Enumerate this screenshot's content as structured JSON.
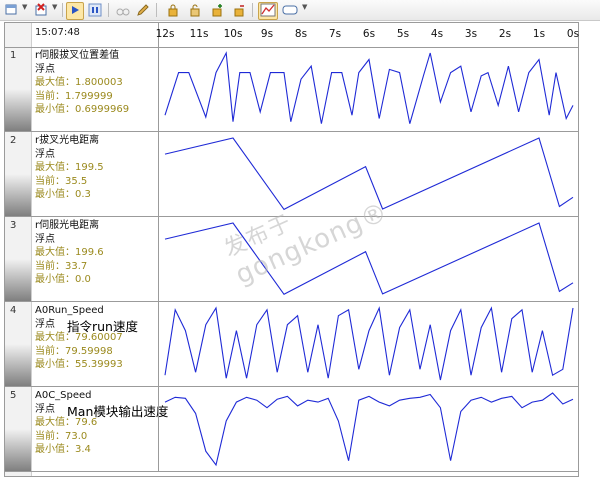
{
  "toolbar": {
    "buttons": [
      "add-channel-icon",
      "remove-channel-icon",
      "start-icon",
      "pause-icon",
      "binoculars-icon",
      "pencil-icon",
      "lock-icon",
      "lock-open-icon",
      "lock-add-icon",
      "lock-remove-icon",
      "chart-icon",
      "display-icon"
    ],
    "active": [
      "start-icon",
      "chart-icon"
    ]
  },
  "header": {
    "time": "15:07:48"
  },
  "axis": {
    "ticks": [
      "12s",
      "11s",
      "10s",
      "9s",
      "8s",
      "7s",
      "6s",
      "5s",
      "4s",
      "3s",
      "2s",
      "1s",
      "0s"
    ]
  },
  "channels": [
    {
      "num": "1",
      "name": "r伺服拔叉位置差值",
      "type": "浮点",
      "max": "最大值：1.800003",
      "cur": "当前：1.799999",
      "min": "最小值：0.6999969",
      "note": ""
    },
    {
      "num": "2",
      "name": "r拔叉光电距离",
      "type": "浮点",
      "max": "最大值：199.5",
      "cur": "当前：35.5",
      "min": "最小值：0.3",
      "note": ""
    },
    {
      "num": "3",
      "name": "r伺服光电距离",
      "type": "浮点",
      "max": "最大值：199.6",
      "cur": "当前：33.7",
      "min": "最小值：0.0",
      "note": ""
    },
    {
      "num": "4",
      "name": "A0Run_Speed",
      "type": "浮点",
      "max": "最大值：79.60007",
      "cur": "当前：79.59998",
      "min": "最小值：55.39993",
      "note": "指令run速度"
    },
    {
      "num": "5",
      "name": "A0C_Speed",
      "type": "浮点",
      "max": "最大值：79.6",
      "cur": "当前：73.0",
      "min": "最小值：3.4",
      "note": "Man模块输出速度"
    }
  ],
  "watermark": {
    "line1": "发布于",
    "line2": "gongkong®"
  },
  "colors": {
    "trace": "#1f2ad6",
    "stat": "#9b8a1e",
    "grid": "#9b9b9b"
  },
  "chart_data": [
    {
      "type": "line",
      "channel": "r伺服拔叉位置差值",
      "x_unit": "s before now",
      "xlim": [
        12,
        0
      ],
      "ylim": [
        0.6999969,
        1.800003
      ],
      "x": [
        12,
        11.6,
        11.3,
        10.8,
        10.5,
        10.2,
        10.0,
        9.8,
        9.5,
        9.2,
        8.9,
        8.5,
        8.3,
        8.0,
        7.7,
        7.4,
        7.1,
        6.8,
        6.5,
        6.3,
        6.0,
        5.7,
        5.4,
        5.1,
        4.8,
        4.4,
        4.2,
        3.9,
        3.6,
        3.3,
        3.0,
        2.7,
        2.5,
        2.2,
        1.9,
        1.6,
        1.3,
        1.0,
        0.7,
        0.5,
        0.2,
        0.0
      ],
      "y": [
        0.85,
        1.5,
        1.5,
        0.82,
        1.5,
        1.8,
        0.75,
        1.5,
        1.5,
        0.9,
        1.5,
        1.5,
        0.75,
        1.4,
        1.6,
        0.72,
        1.5,
        1.5,
        0.85,
        1.5,
        1.7,
        0.8,
        1.55,
        1.5,
        0.72,
        1.45,
        1.8,
        1.05,
        1.5,
        1.6,
        0.9,
        1.45,
        1.5,
        1.0,
        1.6,
        0.9,
        1.5,
        1.7,
        0.85,
        1.5,
        0.8,
        1.0
      ]
    },
    {
      "type": "line",
      "channel": "r拔叉光电距离",
      "x_unit": "s before now",
      "xlim": [
        12,
        0
      ],
      "ylim": [
        0.3,
        199.5
      ],
      "x": [
        12,
        10.0,
        8.5,
        6.1,
        5.6,
        1.0,
        0.4,
        0.0
      ],
      "y": [
        155,
        199.5,
        2,
        120,
        3,
        199.5,
        10,
        35.5
      ]
    },
    {
      "type": "line",
      "channel": "r伺服光电距离",
      "x_unit": "s before now",
      "xlim": [
        12,
        0
      ],
      "ylim": [
        0.0,
        199.6
      ],
      "x": [
        12,
        10.0,
        8.5,
        6.1,
        5.6,
        1.0,
        0.4,
        0.0
      ],
      "y": [
        155,
        199.6,
        2,
        120,
        3,
        199.6,
        10,
        33.7
      ]
    },
    {
      "type": "line",
      "channel": "A0Run_Speed",
      "x_unit": "s before now",
      "xlim": [
        12,
        0
      ],
      "ylim": [
        55.39993,
        79.60007
      ],
      "x": [
        12,
        11.7,
        11.4,
        11.1,
        10.8,
        10.5,
        10.2,
        9.9,
        9.6,
        9.3,
        9.0,
        8.7,
        8.4,
        8.1,
        7.8,
        7.5,
        7.2,
        6.9,
        6.6,
        6.3,
        6.0,
        5.7,
        5.4,
        5.1,
        4.8,
        4.5,
        4.2,
        3.9,
        3.6,
        3.3,
        3.0,
        2.7,
        2.4,
        2.1,
        1.8,
        1.5,
        1.2,
        0.9,
        0.6,
        0.3,
        0.0
      ],
      "y": [
        57,
        79,
        72,
        58,
        74,
        79.6,
        56,
        72,
        56,
        74,
        79,
        58,
        74,
        77,
        58,
        74,
        56,
        77,
        79,
        59,
        72,
        79.6,
        57,
        73,
        79,
        59,
        74,
        55.4,
        72,
        79,
        57,
        73,
        79.6,
        58,
        76,
        79,
        58,
        72,
        57,
        59,
        79.6
      ]
    },
    {
      "type": "line",
      "channel": "A0C_Speed",
      "x_unit": "s before now",
      "xlim": [
        12,
        0
      ],
      "ylim": [
        3.4,
        79.6
      ],
      "x": [
        12,
        11.7,
        11.4,
        11.1,
        10.8,
        10.5,
        10.2,
        9.9,
        9.6,
        9.3,
        9.0,
        8.7,
        8.4,
        8.1,
        7.8,
        7.5,
        7.2,
        6.9,
        6.6,
        6.3,
        6.0,
        5.7,
        5.4,
        5.1,
        4.8,
        4.5,
        4.2,
        3.9,
        3.6,
        3.3,
        3.0,
        2.7,
        2.4,
        2.1,
        1.8,
        1.5,
        1.2,
        0.9,
        0.6,
        0.3,
        0.0
      ],
      "y": [
        70,
        75,
        74,
        58,
        18,
        3.4,
        50,
        70,
        75,
        72,
        64,
        73,
        76,
        66,
        72,
        70,
        74,
        50,
        8,
        72,
        76,
        70,
        66,
        72,
        74,
        75,
        78,
        64,
        8,
        60,
        72,
        75,
        70,
        74,
        76,
        64,
        70,
        72,
        79.6,
        68,
        73
      ]
    }
  ]
}
